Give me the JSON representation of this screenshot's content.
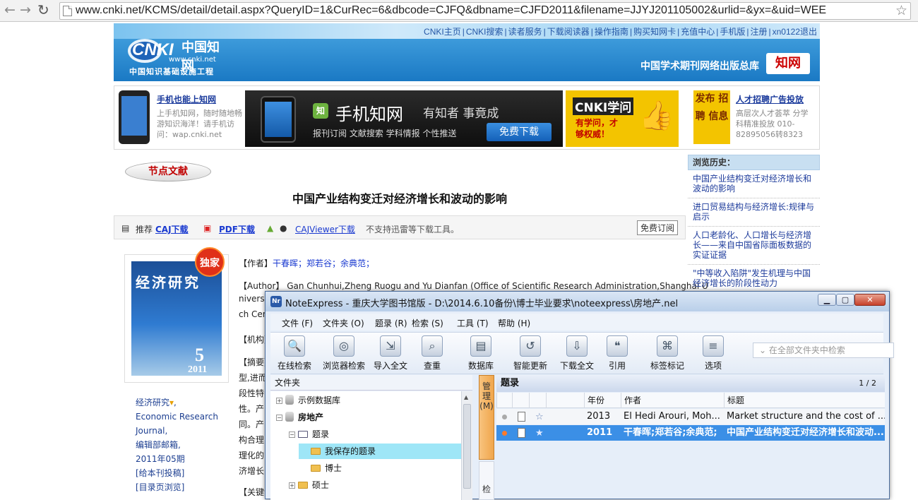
{
  "browser": {
    "url": "www.cnki.net/KCMS/detail/detail.aspx?QueryID=1&CurRec=6&dbcode=CJFQ&dbname=CJFD2011&filename=JJYJ201105002&urlid=&yx=&uid=WEE",
    "back_glyph": "←",
    "forward_glyph": "→",
    "reload_glyph": "↻",
    "star_glyph": "☆"
  },
  "header": {
    "topnav": [
      "CNKI主页",
      "CNKI搜索",
      "读者服务",
      "下载阅读器",
      "操作指南",
      "购买知网卡",
      "充值中心",
      "手机版",
      "注册",
      "xn0122退出"
    ],
    "logo_cn": "中国知网",
    "logo_en": "CNKI",
    "logo_url": "www.cnki.net",
    "logo_sub": "中国知识基础设施工程",
    "banner_title": "中国学术期刊网络出版总库",
    "banner_logo": "知网"
  },
  "ads": {
    "mobile_link": "手机也能上知网",
    "mobile_text": "上手机知网，随时随地畅游知识海洋！请手机访问：wap.cnki.net",
    "app_title": "手机知网",
    "app_slogan": "有知者 事竟成",
    "app_features": "报刊订阅 文献搜索 学科情报 个性推送",
    "app_download": "免费下载",
    "xuewen_title": "CNKI学问",
    "xuewen_sub": "有学问，才够权威！",
    "recruit_badge": "发布 招聘 信息",
    "recruit_link": "人才招聘广告投放",
    "recruit_text": "高层次人才荟萃 分学科精准投放 010-82895056转8323"
  },
  "article": {
    "section_tag": "节点文献",
    "title": "中国产业结构变迁对经济增长和波动的影响",
    "download_bar": {
      "recommend": "推荐",
      "caj": "CAJ下载",
      "pdf": "PDF下载",
      "cajviewer": "CAJViewer下载",
      "note": "不支持迅雷等下载工具。",
      "subscribe": "免费订阅"
    },
    "authors_label": "【作者】",
    "authors": "干春晖；郑若谷；余典范；",
    "author_en_label": "【Author】",
    "author_en_l1": "Gan Chunhui,Zheng Ruogu and Yu Dianfan (Office of Scientific Research Administration,Shanghai U",
    "author_en_l2": "niversi",
    "author_en_l3": "ch Cen",
    "inst_label": "【机构】",
    "abstract_label": "【摘要】",
    "abstract_lines": [
      "型,进而",
      "段性特",
      "性。产",
      "同。产",
      "构合理",
      "理化的",
      "济增长"
    ],
    "keywords_label": "【关键词"
  },
  "journal": {
    "cover_title": "经济研究",
    "cover_issue": "5",
    "cover_year": "2011",
    "badge": "独家",
    "name_cn": "经济研究",
    "name_en_1": "Economic Research",
    "name_en_2": "Journal",
    "edit_office": "编辑部邮箱",
    "issue": "2011年05期",
    "submit": "[给本刊投稿]",
    "toc": "[目录页浏览]"
  },
  "history": {
    "title": "浏览历史：",
    "items": [
      "中国产业结构变迁对经济增长和波动的影响",
      "进口贸易结构与经济增长:规律与启示",
      "人口老龄化、人口增长与经济增长——来自中国省际面板数据的实证证据",
      "\"中等收入陷阱\"发生机理与中国经济增长的阶段性动力"
    ]
  },
  "noteexpress": {
    "title": "NoteExpress - 重庆大学图书馆版 - D:\\2014.6.10备份\\博士毕业要求\\noteexpress\\房地产.nel",
    "app_icon": "Nr",
    "menu": [
      "文件 (F)",
      "文件夹 (O)",
      "题录 (R)",
      "检索 (S)",
      "工具 (T)",
      "帮助 (H)"
    ],
    "tools": [
      {
        "label": "在线检索",
        "icon": "search-online-icon",
        "glyph": "🔍"
      },
      {
        "label": "浏览器检索",
        "icon": "browser-icon",
        "glyph": "◎"
      },
      {
        "label": "导入全文",
        "icon": "import-icon",
        "glyph": "⇲"
      },
      {
        "label": "查重",
        "icon": "dedupe-icon",
        "glyph": "⌕"
      },
      {
        "label": "数据库",
        "icon": "database-icon",
        "glyph": "▤"
      },
      {
        "label": "智能更新",
        "icon": "update-icon",
        "glyph": "↺"
      },
      {
        "label": "下载全文",
        "icon": "download-icon",
        "glyph": "⇩"
      },
      {
        "label": "引用",
        "icon": "cite-icon",
        "glyph": "❝"
      },
      {
        "label": "标签标记",
        "icon": "tag-icon",
        "glyph": "⌘"
      },
      {
        "label": "选项",
        "icon": "options-icon",
        "glyph": "≡"
      }
    ],
    "search_placeholder": "在全部文件夹中检索",
    "folder_header": "文件夹",
    "tree": [
      {
        "label": "示例数据库",
        "kind": "db"
      },
      {
        "label": "房地产",
        "kind": "db"
      },
      {
        "label": "题录",
        "kind": "list"
      },
      {
        "label": "我保存的题录",
        "kind": "folder"
      },
      {
        "label": "博士",
        "kind": "folder"
      },
      {
        "label": "硕士",
        "kind": "folder"
      }
    ],
    "vtab": "管理(M)",
    "vtab2": "检",
    "list_title": "题录",
    "page": "1 / 2",
    "columns": [
      "年份",
      "作者",
      "标题"
    ],
    "rows": [
      {
        "year": "2013",
        "author": "El Hedi Arouri, Moh...",
        "title": "Market structure and the cost of ..."
      },
      {
        "year": "2011",
        "author": "干春晖;郑若谷;余典范;",
        "title": "中国产业结构变迁对经济增长和波动..."
      }
    ]
  }
}
